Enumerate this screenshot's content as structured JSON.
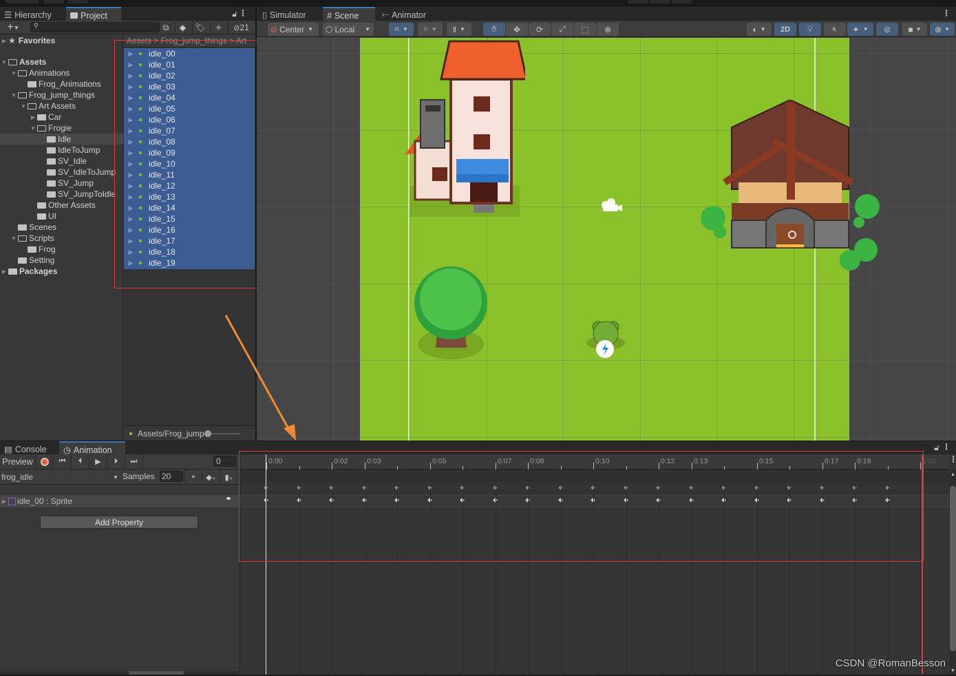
{
  "project_panel": {
    "tabs": [
      {
        "label": "Hierarchy",
        "icon": "list-icon",
        "active": false
      },
      {
        "label": "Project",
        "icon": "folder-icon",
        "active": true
      }
    ],
    "hidden_count": "21",
    "search_placeholder": "",
    "favorites_label": "Favorites",
    "tree": [
      {
        "label": "Assets",
        "depth": 0,
        "expanded": true,
        "bold": true
      },
      {
        "label": "Animations",
        "depth": 1,
        "expanded": true
      },
      {
        "label": "Frog_Animations",
        "depth": 2,
        "expanded": null
      },
      {
        "label": "Frog_jump_things",
        "depth": 1,
        "expanded": true
      },
      {
        "label": "Art Assets",
        "depth": 2,
        "expanded": true
      },
      {
        "label": "Car",
        "depth": 3,
        "expanded": false
      },
      {
        "label": "Frogie",
        "depth": 3,
        "expanded": true
      },
      {
        "label": "Idle",
        "depth": 4,
        "expanded": null,
        "selected": true
      },
      {
        "label": "IdleToJump",
        "depth": 4,
        "expanded": null
      },
      {
        "label": "SV_Idle",
        "depth": 4,
        "expanded": null
      },
      {
        "label": "SV_IdleToJump",
        "depth": 4,
        "expanded": null
      },
      {
        "label": "SV_Jump",
        "depth": 4,
        "expanded": null
      },
      {
        "label": "SV_JumpToIdle",
        "depth": 4,
        "expanded": null
      },
      {
        "label": "Other Assets",
        "depth": 3,
        "expanded": null
      },
      {
        "label": "UI",
        "depth": 3,
        "expanded": null
      },
      {
        "label": "Scenes",
        "depth": 1,
        "expanded": null
      },
      {
        "label": "Scripts",
        "depth": 1,
        "expanded": true
      },
      {
        "label": "Frog",
        "depth": 2,
        "expanded": null
      },
      {
        "label": "Setting",
        "depth": 1,
        "expanded": null
      },
      {
        "label": "Packages",
        "depth": 0,
        "expanded": false,
        "bold": true
      }
    ],
    "breadcrumb": [
      "Assets",
      "Frog_jump_things",
      "Art"
    ],
    "files": [
      "idle_00",
      "idle_01",
      "idle_02",
      "idle_03",
      "idle_04",
      "idle_05",
      "idle_06",
      "idle_07",
      "idle_08",
      "idle_09",
      "idle_10",
      "idle_11",
      "idle_12",
      "idle_13",
      "idle_14",
      "idle_15",
      "idle_16",
      "idle_17",
      "idle_18",
      "idle_19"
    ],
    "status_path": "Assets/Frog_jump"
  },
  "scene_panel": {
    "tabs": [
      {
        "label": "Simulator",
        "icon": "device-icon",
        "active": false
      },
      {
        "label": "Scene",
        "icon": "grid-icon",
        "active": true
      },
      {
        "label": "Animator",
        "icon": "animator-icon",
        "active": false
      }
    ],
    "pivot_mode": "Center",
    "pivot_rotation": "Local",
    "mode_2d_label": "2D"
  },
  "animation_panel": {
    "tabs": [
      {
        "label": "Console",
        "icon": "console-icon",
        "active": false
      },
      {
        "label": "Animation",
        "icon": "clock-icon",
        "active": true
      }
    ],
    "preview_label": "Preview",
    "frame_value": "0",
    "clip_name": "frog_idle",
    "samples_label": "Samples",
    "samples_value": "20",
    "property_label": "idle_00 : Sprite",
    "add_property_label": "Add Property",
    "ruler_labels": [
      "0:00",
      "0:02",
      "0:03",
      "0:05",
      "0:07",
      "0:08",
      "0:10",
      "0:12",
      "0:13",
      "0:15",
      "0:17",
      "0:18",
      "1:00"
    ],
    "keyframe_count": 20
  },
  "watermark": "CSDN @RomanBesson",
  "colors": {
    "selection": "#3c5d93",
    "annotation": "#e0393d",
    "arrow": "#f08a30",
    "grass": "#8bc22c"
  }
}
